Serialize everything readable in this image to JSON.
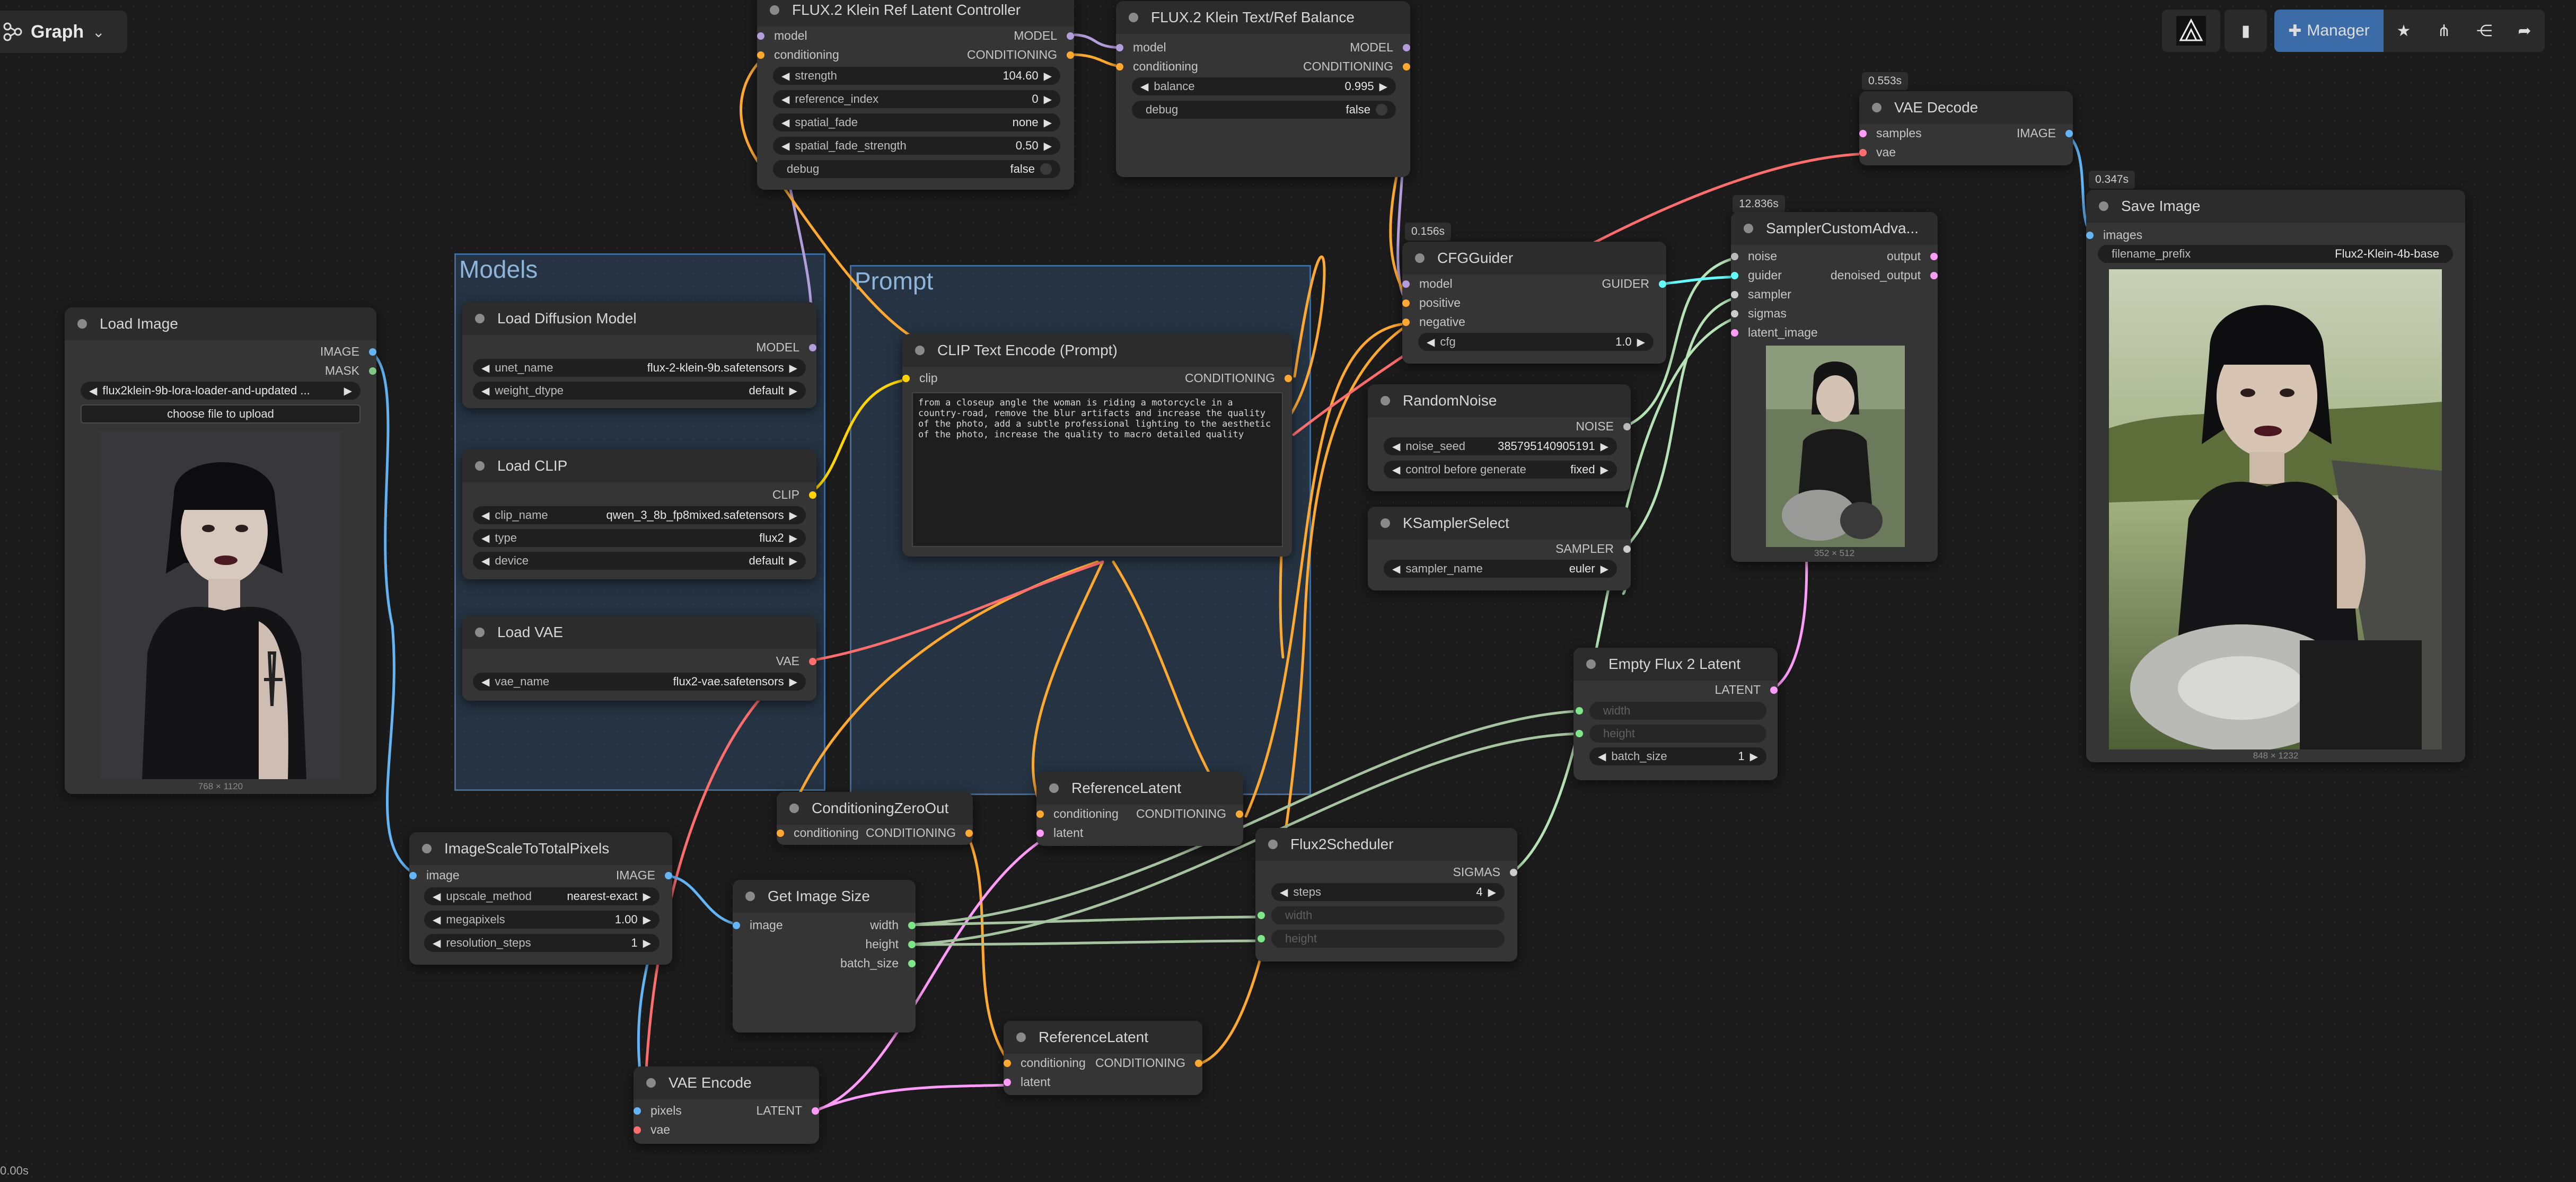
{
  "graph_tab": {
    "label": "Graph"
  },
  "toolbar": {
    "manager_label": "Manager"
  },
  "status": {
    "time": "0.00s"
  },
  "colors": {
    "model": "#b39ddb",
    "conditioning": "#ffa931",
    "clip": "#ffd500",
    "vae": "#ff6e6e",
    "image": "#64b5f6",
    "mask": "#81c784",
    "latent": "#ff9cf9",
    "int": "#7ee787",
    "sampler": "#cccccc",
    "guider": "#66ffff",
    "noise": "#bbbbbb",
    "sigmas": "#cccccc",
    "node_bg": "#353535",
    "group_border": "#3e6d9d",
    "manager_btn": "#3c6ca8"
  },
  "groups": {
    "models": "Models",
    "prompt": "Prompt"
  },
  "nodes": {
    "load_image": {
      "title": "Load Image",
      "out_image": "IMAGE",
      "out_mask": "MASK",
      "image_value": "flux2klein-9b-lora-loader-and-updated ...",
      "upload_btn": "choose file to upload",
      "dims": "768 × 1120"
    },
    "load_diffusion": {
      "title": "Load Diffusion Model",
      "out": "MODEL",
      "w1_label": "unet_name",
      "w1_value": "flux-2-klein-9b.safetensors",
      "w2_label": "weight_dtype",
      "w2_value": "default"
    },
    "load_clip": {
      "title": "Load CLIP",
      "out": "CLIP",
      "w1_label": "clip_name",
      "w1_value": "qwen_3_8b_fp8mixed.safetensors",
      "w2_label": "type",
      "w2_value": "flux2",
      "w3_label": "device",
      "w3_value": "default"
    },
    "load_vae": {
      "title": "Load VAE",
      "out": "VAE",
      "w1_label": "vae_name",
      "w1_value": "flux2-vae.safetensors"
    },
    "ref_latent_ctrl": {
      "title": "FLUX.2 Klein Ref Latent Controller",
      "in_model": "model",
      "in_cond": "conditioning",
      "out_model": "MODEL",
      "out_cond": "CONDITIONING",
      "w1_label": "strength",
      "w1_value": "104.60",
      "w2_label": "reference_index",
      "w2_value": "0",
      "w3_label": "spatial_fade",
      "w3_value": "none",
      "w4_label": "spatial_fade_strength",
      "w4_value": "0.50",
      "w5_label": "debug",
      "w5_value": "false"
    },
    "text_ref_balance": {
      "title": "FLUX.2 Klein Text/Ref Balance",
      "in_model": "model",
      "in_cond": "conditioning",
      "out_model": "MODEL",
      "out_cond": "CONDITIONING",
      "w1_label": "balance",
      "w1_value": "0.995",
      "w2_label": "debug",
      "w2_value": "false"
    },
    "clip_text": {
      "title": "CLIP Text Encode (Prompt)",
      "in_clip": "clip",
      "out": "CONDITIONING",
      "text": "from a closeup angle the woman is riding a motorcycle in a country-road, remove the blur artifacts and increase the quality of the photo, add a subtle professional lighting to the aesthetic of the photo, increase the quality to macro detailed quality"
    },
    "cfg_guider": {
      "title": "CFGGuider",
      "badge": "0.156s",
      "in_model": "model",
      "in_pos": "positive",
      "in_neg": "negative",
      "out": "GUIDER",
      "w1_label": "cfg",
      "w1_value": "1.0"
    },
    "random_noise": {
      "title": "RandomNoise",
      "out": "NOISE",
      "w1_label": "noise_seed",
      "w1_value": "385795140905191",
      "w2_label": "control before generate",
      "w2_value": "fixed"
    },
    "ksampler_select": {
      "title": "KSamplerSelect",
      "out": "SAMPLER",
      "w1_label": "sampler_name",
      "w1_value": "euler"
    },
    "sampler_custom": {
      "title": "SamplerCustomAdva...",
      "badge": "12.836s",
      "in_noise": "noise",
      "in_guider": "guider",
      "in_sampler": "sampler",
      "in_sigmas": "sigmas",
      "in_latent": "latent_image",
      "out_output": "output",
      "out_denoised": "denoised_output",
      "dims": "352 × 512"
    },
    "vae_decode": {
      "title": "VAE Decode",
      "badge": "0.553s",
      "in_samples": "samples",
      "in_vae": "vae",
      "out": "IMAGE"
    },
    "save_image": {
      "title": "Save Image",
      "badge": "0.347s",
      "in_images": "images",
      "w1_label": "filename_prefix",
      "w1_value": "Flux2-Klein-4b-base",
      "dims": "848 × 1232"
    },
    "empty_latent": {
      "title": "Empty Flux 2 Latent",
      "out": "LATENT",
      "w1_label": "width",
      "w2_label": "height",
      "w3_label": "batch_size",
      "w3_value": "1"
    },
    "ref_latent_a": {
      "title": "ReferenceLatent",
      "in_cond": "conditioning",
      "in_latent": "latent",
      "out": "CONDITIONING"
    },
    "ref_latent_b": {
      "title": "ReferenceLatent",
      "in_cond": "conditioning",
      "in_latent": "latent",
      "out": "CONDITIONING"
    },
    "cond_zero": {
      "title": "ConditioningZeroOut",
      "in_cond": "conditioning",
      "out": "CONDITIONING"
    },
    "image_scale": {
      "title": "ImageScaleToTotalPixels",
      "in_image": "image",
      "out": "IMAGE",
      "w1_label": "upscale_method",
      "w1_value": "nearest-exact",
      "w2_label": "megapixels",
      "w2_value": "1.00",
      "w3_label": "resolution_steps",
      "w3_value": "1"
    },
    "get_image_size": {
      "title": "Get Image Size",
      "in_image": "image",
      "out_width": "width",
      "out_height": "height",
      "out_batch": "batch_size"
    },
    "flux2_scheduler": {
      "title": "Flux2Scheduler",
      "out": "SIGMAS",
      "w1_label": "steps",
      "w1_value": "4",
      "w2_label": "width",
      "w3_label": "height"
    },
    "vae_encode": {
      "title": "VAE Encode",
      "in_pixels": "pixels",
      "in_vae": "vae",
      "out": "LATENT"
    }
  }
}
